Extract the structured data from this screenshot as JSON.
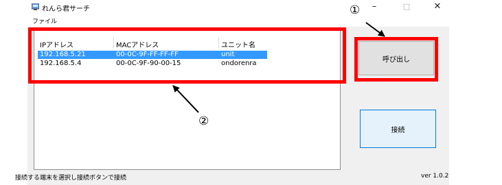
{
  "window": {
    "title": "れんら君サーチ",
    "controls": {
      "minimize": "–",
      "maximize": "□",
      "close": "✕"
    }
  },
  "menu": {
    "file": "ファイル"
  },
  "list": {
    "columns": [
      "IPアドレス",
      "MACアドレス",
      "ユニット名"
    ],
    "rows": [
      {
        "ip": "192.168.5.21",
        "mac": "00-0C-9F-FF-FF-FF",
        "unit": "unit",
        "selected": true
      },
      {
        "ip": "192.168.5.4",
        "mac": "00-0C-9F-90-00-15",
        "unit": "ondorenra",
        "selected": false
      }
    ]
  },
  "buttons": {
    "call": "呼び出し",
    "connect": "接続"
  },
  "status": {
    "message": "接続する端末を選択し接続ボタンで接続",
    "version": "ver 1.0.2"
  },
  "annotations": {
    "callout_1": "①",
    "callout_2": "②",
    "highlight_color": "#ff0000"
  },
  "colors": {
    "selection": "#3399ff",
    "window_bg": "#f0f0f0"
  }
}
